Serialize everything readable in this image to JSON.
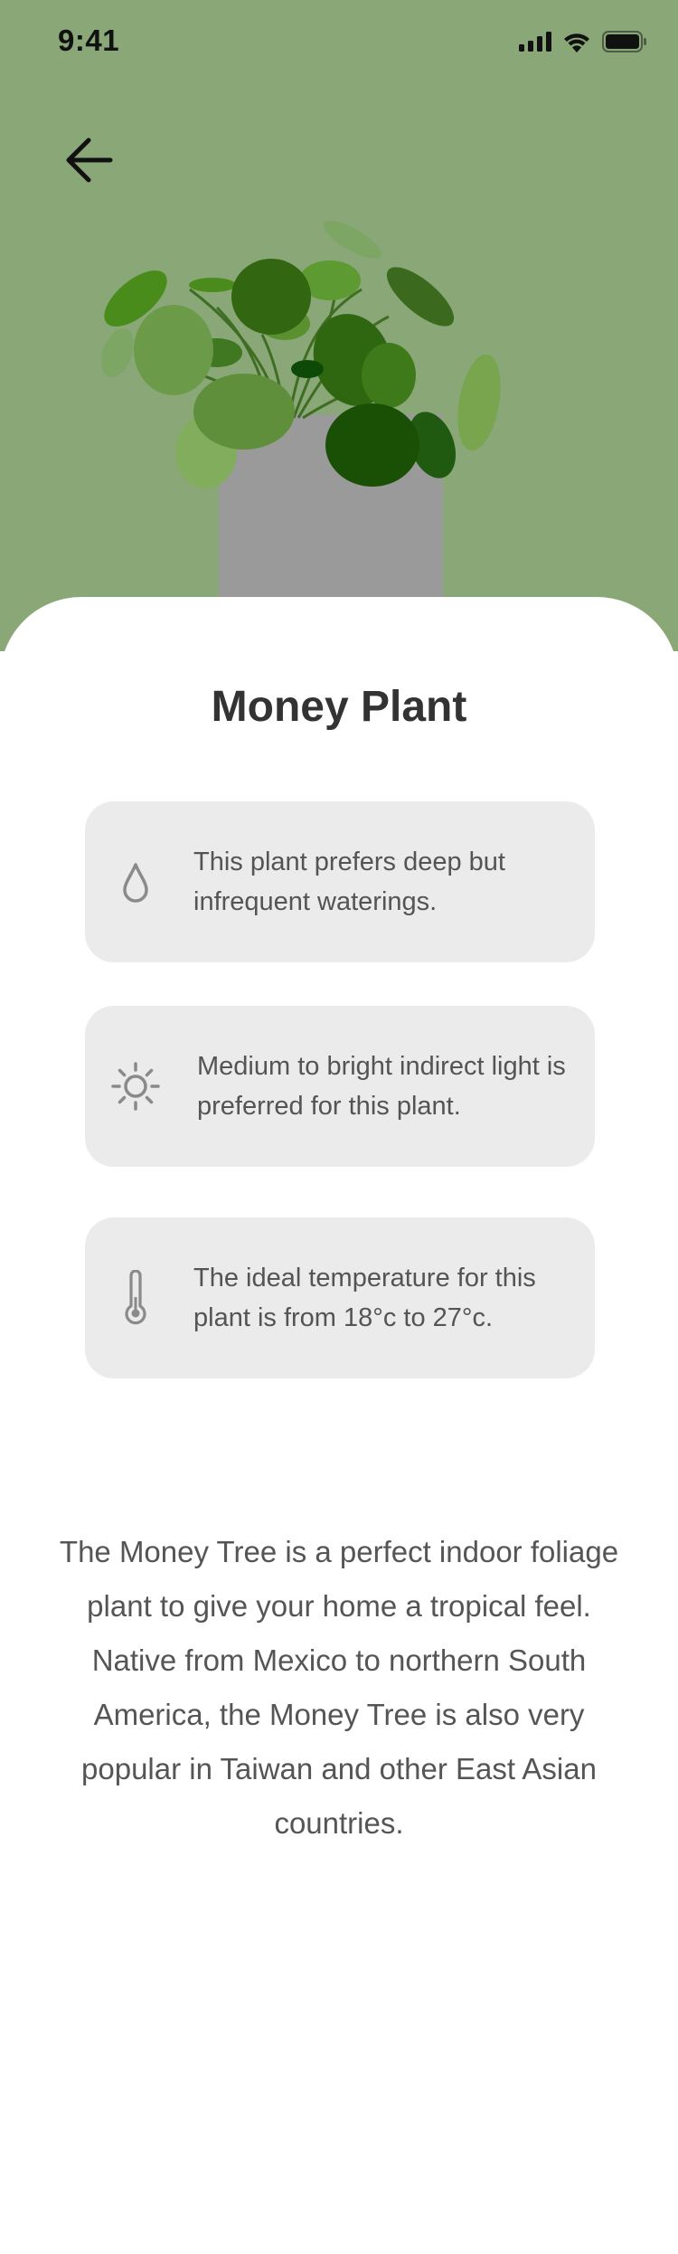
{
  "status_bar": {
    "time": "9:41"
  },
  "colors": {
    "hero_background": "#89a777",
    "card_background": "#ebebeb",
    "title_text": "#333333",
    "body_text": "#555555"
  },
  "icons": {
    "back": "arrow-left-icon",
    "water": "water-drop-icon",
    "light": "sun-icon",
    "temperature": "thermometer-icon"
  },
  "plant": {
    "name": "Money Plant"
  },
  "care": [
    {
      "icon": "water-drop-icon",
      "text": "This plant prefers deep but infrequent waterings."
    },
    {
      "icon": "sun-icon",
      "text": "Medium to bright indirect light is preferred for this plant."
    },
    {
      "icon": "thermometer-icon",
      "text": "The ideal temperature for this plant is from 18°c to 27°c."
    }
  ],
  "description": "The Money Tree is a perfect indoor foliage plant to give your home a tropical feel. Native from Mexico to northern South America, the Money Tree is also very popular in Taiwan and other East Asian countries."
}
